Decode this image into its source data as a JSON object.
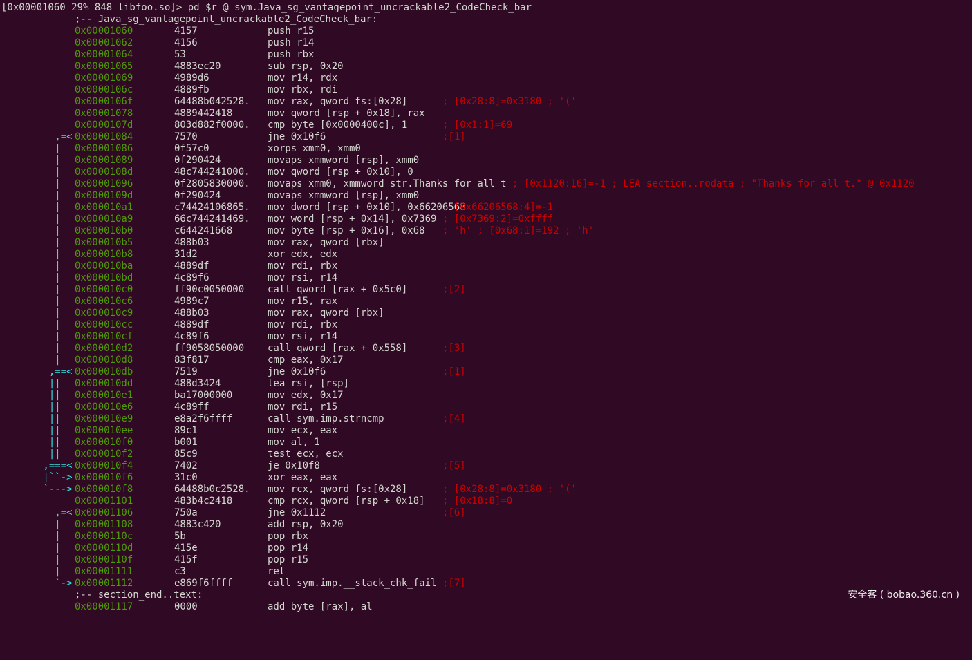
{
  "colors": {
    "background": "#300a24",
    "address": "#4e9a06",
    "comment": "#cc0000",
    "flow": "#34e2e2",
    "text": "#d3d7cf"
  },
  "prompt": "[0x00001060 29% 848 libfoo.so]> pd $r @ sym.Java_sg_vantagepoint_uncrackable2_CodeCheck_bar",
  "function_label": ";-- Java_sg_vantagepoint_uncrackable2_CodeCheck_bar:",
  "end_label": ";-- section_end..text:",
  "watermark": "安全客 ( bobao.360.cn )",
  "lines": [
    {
      "flow": "",
      "addr": "0x00001060",
      "bytes": "4157",
      "dis": "push r15",
      "cmt": ""
    },
    {
      "flow": "",
      "addr": "0x00001062",
      "bytes": "4156",
      "dis": "push r14",
      "cmt": ""
    },
    {
      "flow": "",
      "addr": "0x00001064",
      "bytes": "53",
      "dis": "push rbx",
      "cmt": ""
    },
    {
      "flow": "",
      "addr": "0x00001065",
      "bytes": "4883ec20",
      "dis": "sub rsp, 0x20",
      "cmt": ""
    },
    {
      "flow": "",
      "addr": "0x00001069",
      "bytes": "4989d6",
      "dis": "mov r14, rdx",
      "cmt": ""
    },
    {
      "flow": "",
      "addr": "0x0000106c",
      "bytes": "4889fb",
      "dis": "mov rbx, rdi",
      "cmt": ""
    },
    {
      "flow": "",
      "addr": "0x0000106f",
      "bytes": "64488b042528.",
      "dis": "mov rax, qword fs:[0x28]",
      "cmt": "; [0x28:8]=0x3180 ; '('"
    },
    {
      "flow": "",
      "addr": "0x00001078",
      "bytes": "4889442418",
      "dis": "mov qword [rsp + 0x18], rax",
      "cmt": ""
    },
    {
      "flow": "",
      "addr": "0x0000107d",
      "bytes": "803d882f0000.",
      "dis": "cmp byte [0x0000400c], 1",
      "cmt": "; [0x1:1]=69"
    },
    {
      "flow": "   ,=<",
      "addr": "0x00001084",
      "bytes": "7570",
      "dis": "jne 0x10f6",
      "cmt": ";[1]"
    },
    {
      "flow": "   |",
      "addr": "0x00001086",
      "bytes": "0f57c0",
      "dis": "xorps xmm0, xmm0",
      "cmt": ""
    },
    {
      "flow": "   |",
      "addr": "0x00001089",
      "bytes": "0f290424",
      "dis": "movaps xmmword [rsp], xmm0",
      "cmt": ""
    },
    {
      "flow": "   |",
      "addr": "0x0000108d",
      "bytes": "48c744241000.",
      "dis": "mov qword [rsp + 0x10], 0",
      "cmt": ""
    },
    {
      "flow": "   |",
      "addr": "0x00001096",
      "bytes": "0f2805830000.",
      "dis": "movaps xmm0, xmmword str.Thanks_for_all_t",
      "cmt": "; [0x1120:16]=-1 ; LEA section..rodata ; \"Thanks for all t.\" @ 0x1120"
    },
    {
      "flow": "   |",
      "addr": "0x0000109d",
      "bytes": "0f290424",
      "dis": "movaps xmmword [rsp], xmm0",
      "cmt": ""
    },
    {
      "flow": "   |",
      "addr": "0x000010a1",
      "bytes": "c74424106865.",
      "dis": "mov dword [rsp + 0x10], 0x66206568",
      "cmt": "; [0x66206568:4]=-1"
    },
    {
      "flow": "   |",
      "addr": "0x000010a9",
      "bytes": "66c744241469.",
      "dis": "mov word [rsp + 0x14], 0x7369",
      "cmt": "; [0x7369:2]=0xffff"
    },
    {
      "flow": "   |",
      "addr": "0x000010b0",
      "bytes": "c644241668",
      "dis": "mov byte [rsp + 0x16], 0x68",
      "cmt": "; 'h' ; [0x68:1]=192 ; 'h'"
    },
    {
      "flow": "   |",
      "addr": "0x000010b5",
      "bytes": "488b03",
      "dis": "mov rax, qword [rbx]",
      "cmt": ""
    },
    {
      "flow": "   |",
      "addr": "0x000010b8",
      "bytes": "31d2",
      "dis": "xor edx, edx",
      "cmt": ""
    },
    {
      "flow": "   |",
      "addr": "0x000010ba",
      "bytes": "4889df",
      "dis": "mov rdi, rbx",
      "cmt": ""
    },
    {
      "flow": "   |",
      "addr": "0x000010bd",
      "bytes": "4c89f6",
      "dis": "mov rsi, r14",
      "cmt": ""
    },
    {
      "flow": "   |",
      "addr": "0x000010c0",
      "bytes": "ff90c0050000",
      "dis": "call qword [rax + 0x5c0]",
      "cmt": ";[2]"
    },
    {
      "flow": "   |",
      "addr": "0x000010c6",
      "bytes": "4989c7",
      "dis": "mov r15, rax",
      "cmt": ""
    },
    {
      "flow": "   |",
      "addr": "0x000010c9",
      "bytes": "488b03",
      "dis": "mov rax, qword [rbx]",
      "cmt": ""
    },
    {
      "flow": "   |",
      "addr": "0x000010cc",
      "bytes": "4889df",
      "dis": "mov rdi, rbx",
      "cmt": ""
    },
    {
      "flow": "   |",
      "addr": "0x000010cf",
      "bytes": "4c89f6",
      "dis": "mov rsi, r14",
      "cmt": ""
    },
    {
      "flow": "   |",
      "addr": "0x000010d2",
      "bytes": "ff9058050000",
      "dis": "call qword [rax + 0x558]",
      "cmt": ";[3]"
    },
    {
      "flow": "   |",
      "addr": "0x000010d8",
      "bytes": "83f817",
      "dis": "cmp eax, 0x17",
      "cmt": ""
    },
    {
      "flow": "  ,==<",
      "addr": "0x000010db",
      "bytes": "7519",
      "dis": "jne 0x10f6",
      "cmt": ";[1]"
    },
    {
      "flow": "  ||",
      "addr": "0x000010dd",
      "bytes": "488d3424",
      "dis": "lea rsi, [rsp]",
      "cmt": ""
    },
    {
      "flow": "  ||",
      "addr": "0x000010e1",
      "bytes": "ba17000000",
      "dis": "mov edx, 0x17",
      "cmt": ""
    },
    {
      "flow": "  ||",
      "addr": "0x000010e6",
      "bytes": "4c89ff",
      "dis": "mov rdi, r15",
      "cmt": ""
    },
    {
      "flow": "  ||",
      "addr": "0x000010e9",
      "bytes": "e8a2f6ffff",
      "dis": "call sym.imp.strncmp",
      "cmt": ";[4]"
    },
    {
      "flow": "  ||",
      "addr": "0x000010ee",
      "bytes": "89c1",
      "dis": "mov ecx, eax",
      "cmt": ""
    },
    {
      "flow": "  ||",
      "addr": "0x000010f0",
      "bytes": "b001",
      "dis": "mov al, 1",
      "cmt": ""
    },
    {
      "flow": "  ||",
      "addr": "0x000010f2",
      "bytes": "85c9",
      "dis": "test ecx, ecx",
      "cmt": ""
    },
    {
      "flow": " ,===<",
      "addr": "0x000010f4",
      "bytes": "7402",
      "dis": "je 0x10f8",
      "cmt": ";[5]"
    },
    {
      "flow": " |``->",
      "addr": "0x000010f6",
      "bytes": "31c0",
      "dis": "xor eax, eax",
      "cmt": ""
    },
    {
      "flow": " `--->",
      "addr": "0x000010f8",
      "bytes": "64488b0c2528.",
      "dis": "mov rcx, qword fs:[0x28]",
      "cmt": "; [0x28:8]=0x3180 ; '('"
    },
    {
      "flow": "",
      "addr": "0x00001101",
      "bytes": "483b4c2418",
      "dis": "cmp rcx, qword [rsp + 0x18]",
      "cmt": "; [0x18:8]=0"
    },
    {
      "flow": "   ,=<",
      "addr": "0x00001106",
      "bytes": "750a",
      "dis": "jne 0x1112",
      "cmt": ";[6]"
    },
    {
      "flow": "   |",
      "addr": "0x00001108",
      "bytes": "4883c420",
      "dis": "add rsp, 0x20",
      "cmt": ""
    },
    {
      "flow": "   |",
      "addr": "0x0000110c",
      "bytes": "5b",
      "dis": "pop rbx",
      "cmt": ""
    },
    {
      "flow": "   |",
      "addr": "0x0000110d",
      "bytes": "415e",
      "dis": "pop r14",
      "cmt": ""
    },
    {
      "flow": "   |",
      "addr": "0x0000110f",
      "bytes": "415f",
      "dis": "pop r15",
      "cmt": ""
    },
    {
      "flow": "   |",
      "addr": "0x00001111",
      "bytes": "c3",
      "dis": "ret",
      "cmt": ""
    },
    {
      "flow": "   `->",
      "addr": "0x00001112",
      "bytes": "e869f6ffff",
      "dis": "call sym.imp.__stack_chk_fail",
      "cmt": ";[7]"
    }
  ],
  "tail": {
    "addr": "0x00001117",
    "bytes": "0000",
    "dis": "add byte [rax], al"
  }
}
